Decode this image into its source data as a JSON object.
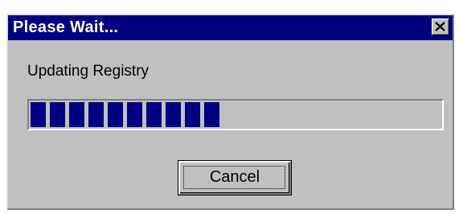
{
  "window": {
    "title": "Please Wait...",
    "close_icon": "close-x-icon"
  },
  "status": {
    "message": "Updating Registry"
  },
  "progress": {
    "filled_blocks": 10,
    "total_blocks": 22,
    "fraction": 0.45
  },
  "buttons": {
    "cancel_label": "Cancel"
  },
  "colors": {
    "titlebar": "#000080",
    "progress_fill": "#000080",
    "face": "#c0c0c0"
  }
}
